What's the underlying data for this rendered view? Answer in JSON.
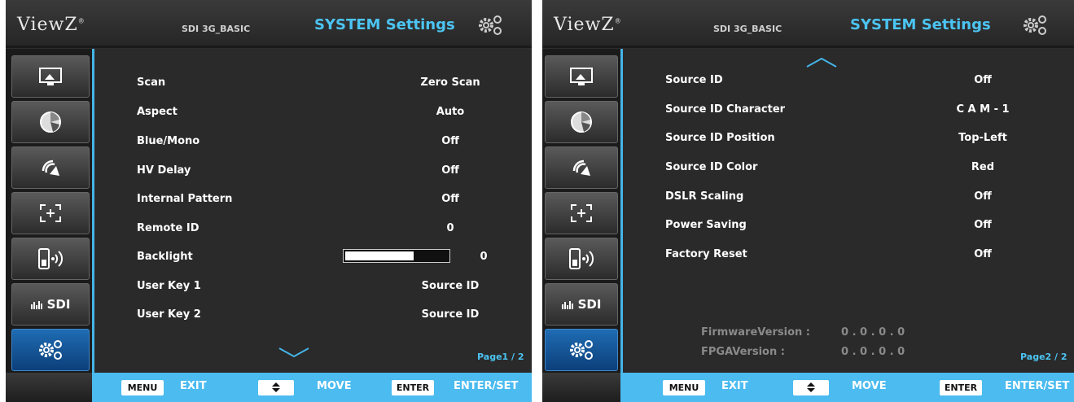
{
  "brand": "ViewZ",
  "model": "SDI 3G_BASIC",
  "title": "SYSTEM Settings",
  "colors": {
    "accent": "#4cc4f2",
    "footer": "#4bbbf0",
    "active_side": "#1f6cb3"
  },
  "sidebar": [
    {
      "icon": "picture-icon"
    },
    {
      "icon": "color-wheel-icon"
    },
    {
      "icon": "audio-signal-icon"
    },
    {
      "icon": "marker-icon"
    },
    {
      "icon": "remote-signal-icon"
    },
    {
      "icon": "sdi-icon",
      "label": "SDI"
    },
    {
      "icon": "system-gear-icon"
    }
  ],
  "page1": {
    "rows": [
      {
        "label": "Scan",
        "value": "Zero Scan"
      },
      {
        "label": "Aspect",
        "value": "Auto"
      },
      {
        "label": "Blue/Mono",
        "value": "Off"
      },
      {
        "label": "HV Delay",
        "value": "Off"
      },
      {
        "label": "Internal Pattern",
        "value": "Off"
      },
      {
        "label": "Remote ID",
        "value": "0"
      },
      {
        "label": "Backlight",
        "value": "0",
        "level": 0.68
      },
      {
        "label": "User Key 1",
        "value": "Source ID"
      },
      {
        "label": "User Key 2",
        "value": "Source ID"
      }
    ],
    "page_indicator": "Page1 / 2"
  },
  "page2": {
    "rows": [
      {
        "label": "Source ID",
        "value": "Off"
      },
      {
        "label": "Source ID Character",
        "value": "C A M - 1"
      },
      {
        "label": "Source ID Position",
        "value": "Top-Left"
      },
      {
        "label": "Source ID Color",
        "value": "Red"
      },
      {
        "label": "DSLR Scaling",
        "value": "Off"
      },
      {
        "label": "Power Saving",
        "value": "Off"
      },
      {
        "label": "Factory Reset",
        "value": "Off"
      }
    ],
    "firmware_label": "FirmwareVersion :",
    "firmware_value": "0 . 0 . 0 . 0",
    "fpga_label": "FPGAVersion :",
    "fpga_value": "0 . 0 . 0 . 0",
    "page_indicator": "Page2 / 2"
  },
  "footer": {
    "menu_key": "MENU",
    "exit": "EXIT",
    "move": "MOVE",
    "enter_key": "ENTER",
    "enter_set": "ENTER/SET"
  }
}
